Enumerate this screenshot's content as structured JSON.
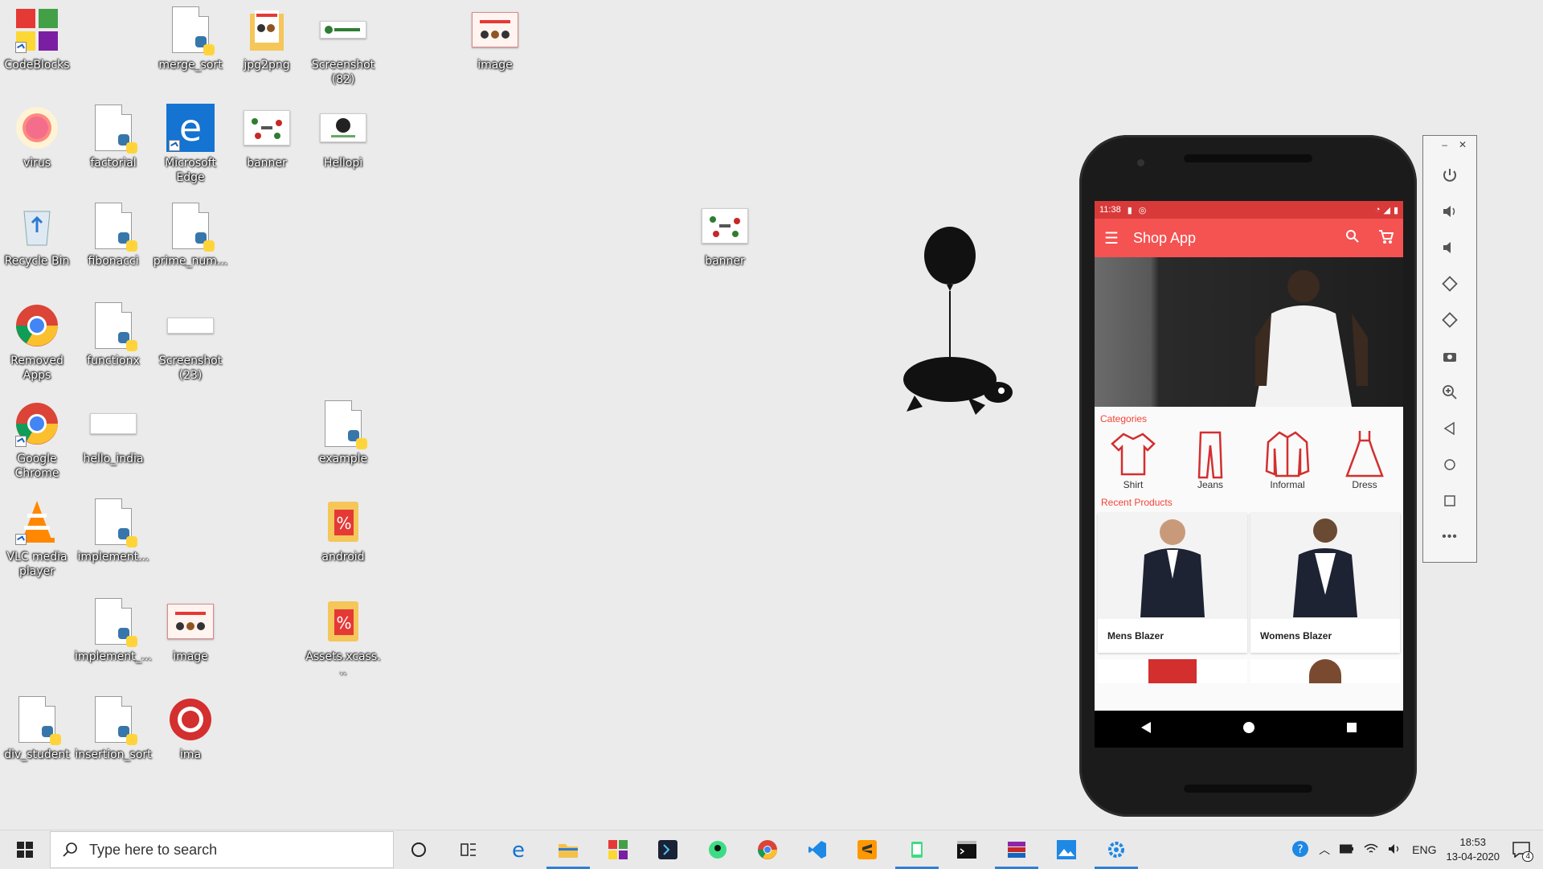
{
  "desktop": {
    "icons": {
      "codeblocks": "CodeBlocks",
      "merge_sort": "merge_sort",
      "jpg2png": "jpg2png",
      "screenshot82": "Screenshot\n(82)",
      "image_top": "image",
      "virus": "virus",
      "factorial": "factorial",
      "edge": "Microsoft\nEdge",
      "banner1": "banner",
      "hellopi": "Hellopi",
      "recycle": "Recycle Bin",
      "fibonacci": "fibonacci",
      "prime": "prime_num...",
      "banner2": "banner",
      "removed_apps": "Removed\nApps",
      "functionx": "functionx",
      "screenshot23": "Screenshot\n(23)",
      "chrome": "Google\nChrome",
      "hello_india": "hello_india",
      "example": "example",
      "vlc": "VLC media\nplayer",
      "implement1": "implement...",
      "android": "android",
      "implement2": "implement_...",
      "image2": "image",
      "assets": "Assets.xcass...",
      "div_student": "div_student",
      "insertion_sort": "insertion_sort",
      "ima": "ima"
    }
  },
  "emulator": {
    "status_time": "11:38",
    "app_title": "Shop App",
    "categories_heading": "Categories",
    "categories": [
      "Shirt",
      "Jeans",
      "Informal",
      "Dress"
    ],
    "recent_heading": "Recent Products",
    "products": [
      "Mens Blazer",
      "Womens Blazer"
    ],
    "accent": "#f55252"
  },
  "taskbar": {
    "search_placeholder": "Type here to search",
    "lang": "ENG",
    "time": "18:53",
    "date": "13-04-2020",
    "notifications": "4"
  }
}
